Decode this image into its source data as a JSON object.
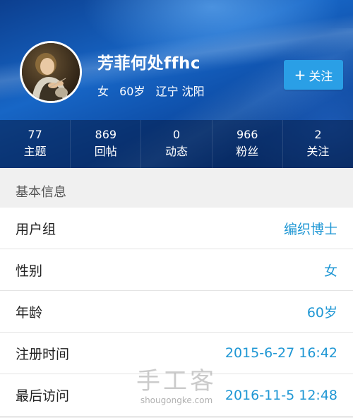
{
  "profile": {
    "username": "芳菲何处ffhc",
    "gender": "女",
    "age": "60岁",
    "location": "辽宁 沈阳",
    "follow_label": "关注",
    "follow_icon": "plus-icon"
  },
  "stats": [
    {
      "value": "77",
      "label": "主题"
    },
    {
      "value": "869",
      "label": "回帖"
    },
    {
      "value": "0",
      "label": "动态"
    },
    {
      "value": "966",
      "label": "粉丝"
    },
    {
      "value": "2",
      "label": "关注"
    }
  ],
  "info": {
    "section_title": "基本信息",
    "rows": [
      {
        "key": "用户组",
        "value": "编织博士"
      },
      {
        "key": "性别",
        "value": "女"
      },
      {
        "key": "年龄",
        "value": "60岁"
      },
      {
        "key": "注册时间",
        "value": "2015-6-27 16:42"
      },
      {
        "key": "最后访问",
        "value": "2016-11-5 12:48"
      }
    ]
  },
  "watermark": {
    "main": "手工客",
    "sub": "shougongke.com"
  },
  "colors": {
    "header_blue": "#1766c6",
    "accent": "#2a9fe6",
    "value_text": "#1f97d4"
  }
}
